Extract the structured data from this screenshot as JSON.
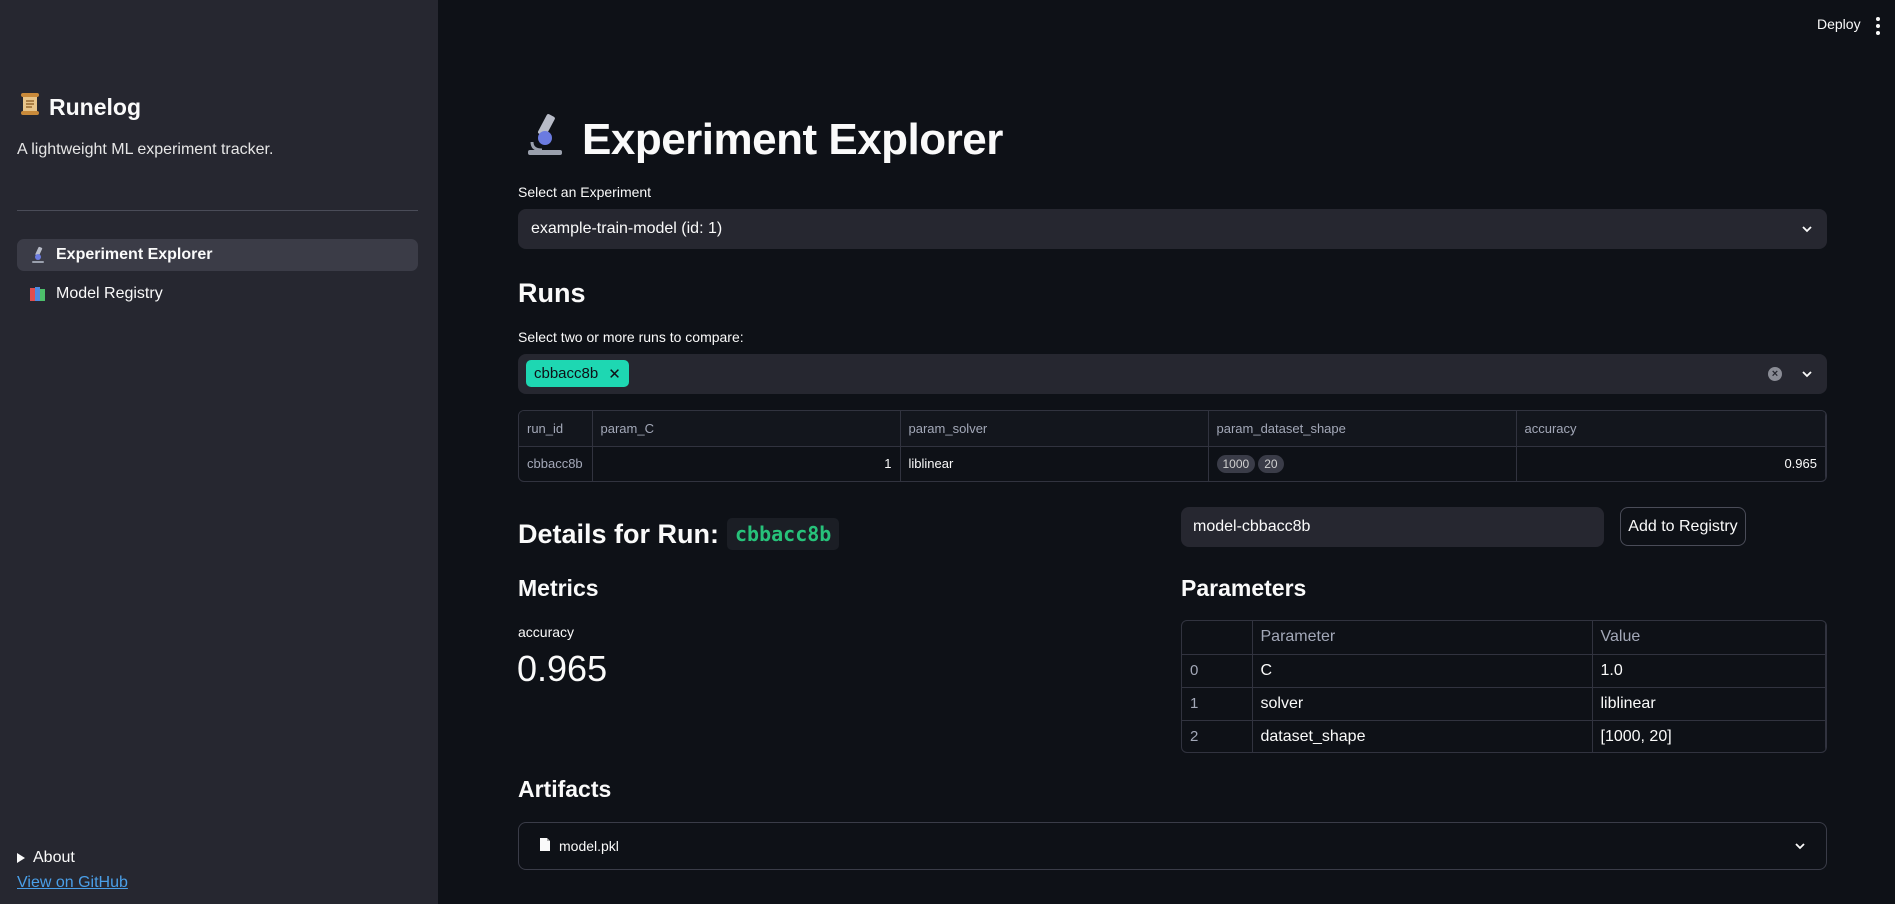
{
  "sidebar": {
    "app_name": "Runelog",
    "app_icon": "scroll-icon",
    "tagline": "A lightweight ML experiment tracker.",
    "nav": [
      {
        "label": "Experiment Explorer",
        "icon": "microscope-icon",
        "active": true
      },
      {
        "label": "Model Registry",
        "icon": "books-icon",
        "active": false
      }
    ],
    "about_label": "About",
    "github_link": "View on GitHub"
  },
  "topbar": {
    "deploy_label": "Deploy"
  },
  "main": {
    "title": "Experiment Explorer",
    "title_icon": "microscope-icon",
    "experiment_select": {
      "label": "Select an Experiment",
      "value": "example-train-model (id: 1)"
    },
    "runs_heading": "Runs",
    "runs_select": {
      "label": "Select two or more runs to compare:",
      "selected": [
        "cbbacc8b"
      ]
    },
    "runs_table": {
      "columns": [
        "run_id",
        "param_C",
        "param_solver",
        "param_dataset_shape",
        "accuracy"
      ],
      "rows": [
        {
          "run_id": "cbbacc8b",
          "param_C": "1",
          "param_solver": "liblinear",
          "param_dataset_shape": [
            "1000",
            "20"
          ],
          "accuracy": "0.965"
        }
      ]
    },
    "details": {
      "heading": "Details for Run:",
      "run_id": "cbbacc8b"
    },
    "registry": {
      "model_name_value": "model-cbbacc8b",
      "add_button": "Add to Registry"
    },
    "metrics": {
      "heading": "Metrics",
      "label": "accuracy",
      "value": "0.965"
    },
    "parameters": {
      "heading": "Parameters",
      "columns": [
        "",
        "Parameter",
        "Value"
      ],
      "rows": [
        {
          "index": "0",
          "parameter": "C",
          "value": "1.0"
        },
        {
          "index": "1",
          "parameter": "solver",
          "value": "liblinear"
        },
        {
          "index": "2",
          "parameter": "dataset_shape",
          "value": "[1000, 20]"
        }
      ]
    },
    "artifacts": {
      "heading": "Artifacts",
      "item": "model.pkl",
      "item_icon": "file-icon"
    }
  },
  "colors": {
    "background": "#0e1117",
    "sidebar": "#262730",
    "chip": "#1ed7b2",
    "code": "#27c27a",
    "link": "#4a9fe8"
  }
}
